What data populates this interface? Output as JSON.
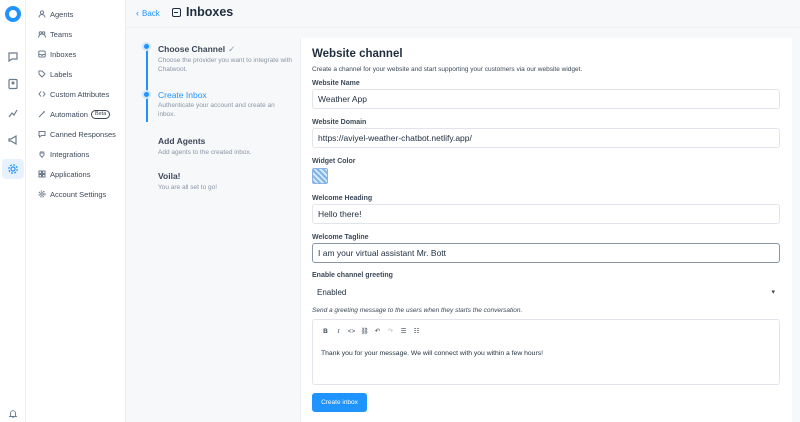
{
  "header": {
    "back_label": "Back",
    "title": "Inboxes"
  },
  "sidebar": {
    "items": [
      {
        "label": "Agents",
        "icon": "person-icon"
      },
      {
        "label": "Teams",
        "icon": "team-icon"
      },
      {
        "label": "Inboxes",
        "icon": "inbox-icon"
      },
      {
        "label": "Labels",
        "icon": "tag-icon"
      },
      {
        "label": "Custom Attributes",
        "icon": "code-icon"
      },
      {
        "label": "Automation",
        "icon": "wand-icon",
        "badge": "Beta"
      },
      {
        "label": "Canned Responses",
        "icon": "chat-icon"
      },
      {
        "label": "Integrations",
        "icon": "plug-icon"
      },
      {
        "label": "Applications",
        "icon": "grid-icon"
      },
      {
        "label": "Account Settings",
        "icon": "settings-icon"
      }
    ]
  },
  "wizard": {
    "steps": [
      {
        "title": "Choose Channel",
        "desc": "Choose the provider you want to integrate with Chatwoot.",
        "status": "done"
      },
      {
        "title": "Create Inbox",
        "desc": "Authenticate your account and create an inbox.",
        "status": "active"
      },
      {
        "title": "Add Agents",
        "desc": "Add agents to the created inbox.",
        "status": "pending"
      },
      {
        "title": "Voila!",
        "desc": "You are all set to go!",
        "status": "pending"
      }
    ]
  },
  "form": {
    "title": "Website channel",
    "description": "Create a channel for your website and start supporting your customers via our website widget.",
    "website_name": {
      "label": "Website Name",
      "value": "Weather App"
    },
    "website_domain": {
      "label": "Website Domain",
      "value": "https://aviyel-weather-chatbot.netlify.app/"
    },
    "widget_color": {
      "label": "Widget Color",
      "value": "#7fb3ea"
    },
    "welcome_heading": {
      "label": "Welcome Heading",
      "value": "Hello there!"
    },
    "welcome_tagline": {
      "label": "Welcome Tagline",
      "value": "I am your virtual assistant Mr. Bott"
    },
    "channel_greeting": {
      "label": "Enable channel greeting",
      "value": "Enabled"
    },
    "greeting_hint": "Send a greeting message to the users when they starts the conversation.",
    "greeting_message": "Thank you for your message. We will connect with you within a few hours!",
    "submit_label": "Create inbox"
  },
  "colors": {
    "accent": "#1f93ff",
    "text": "#1f2d3d"
  }
}
